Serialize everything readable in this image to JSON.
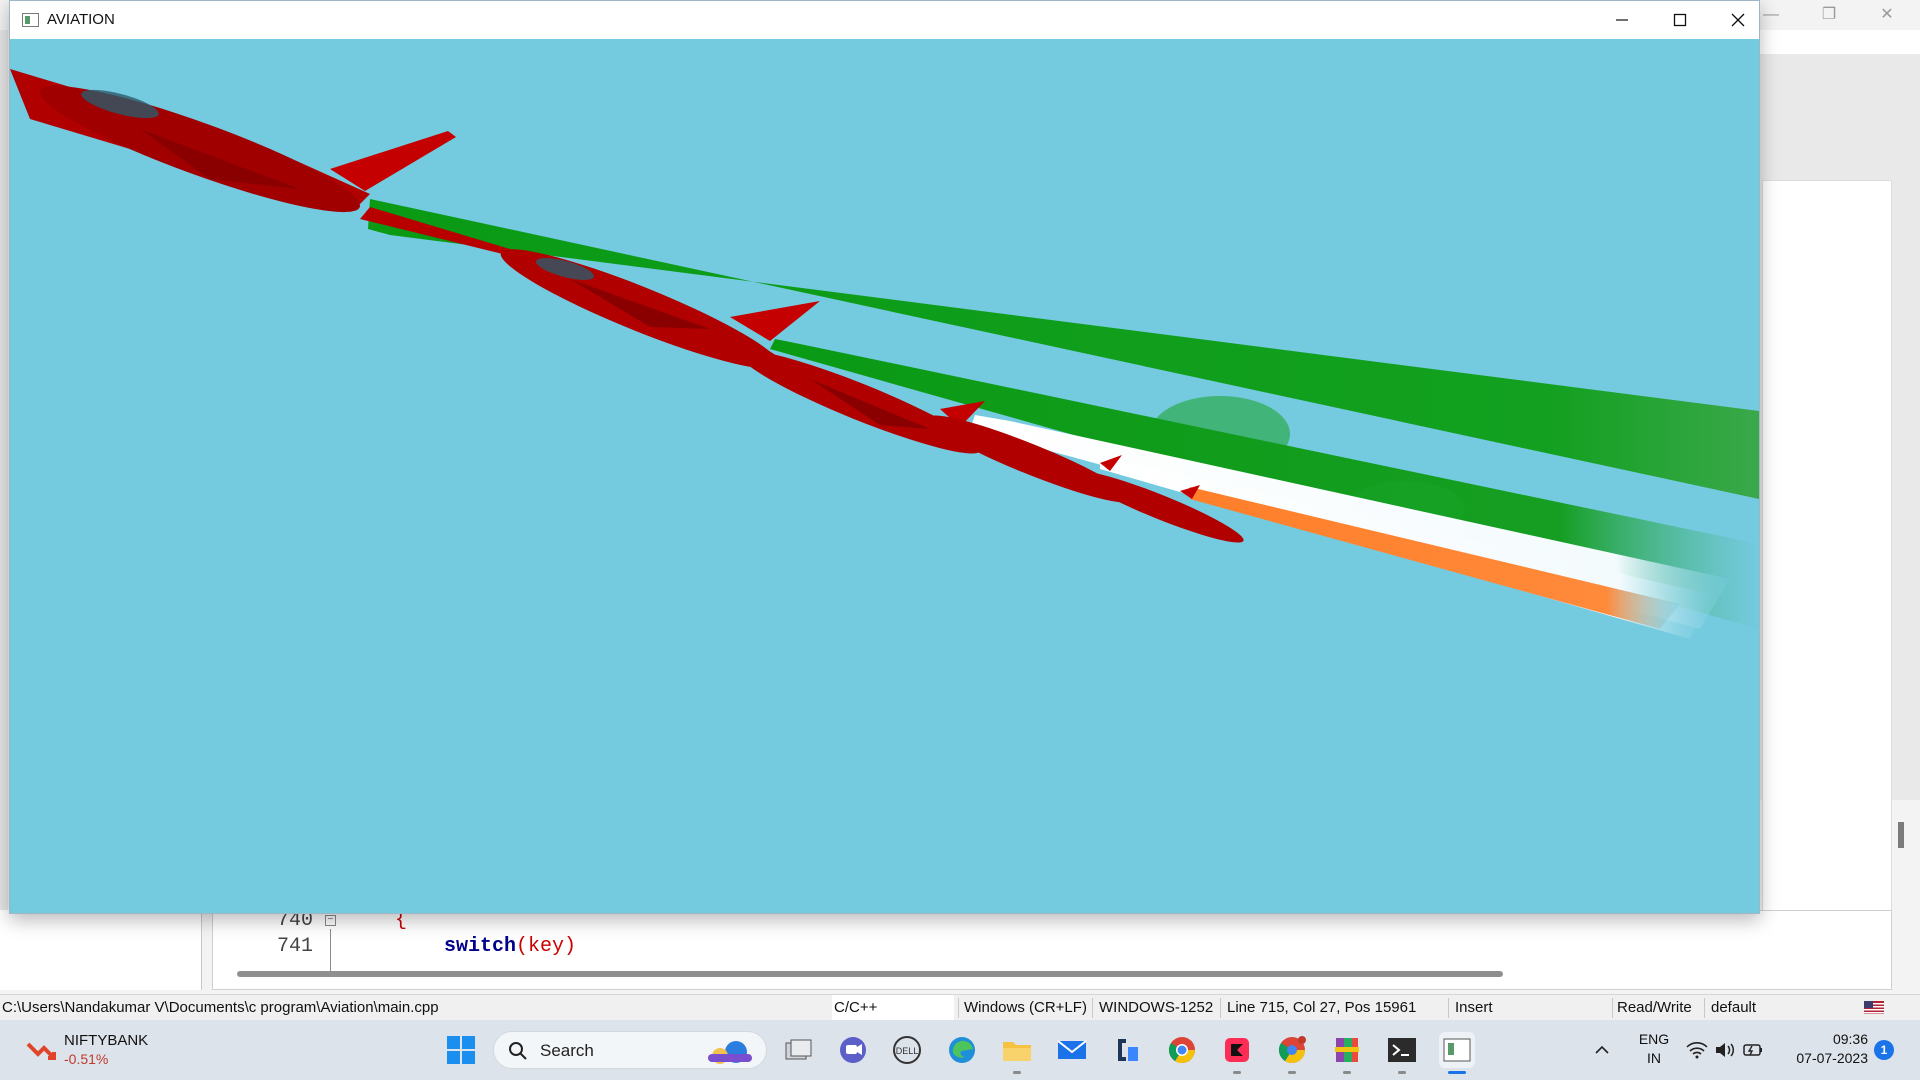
{
  "ide": {
    "statusbar": {
      "path": "C:\\Users\\Nandakumar V\\Documents\\c program\\Aviation\\main.cpp",
      "language": "C/C++",
      "line_endings": "Windows (CR+LF)",
      "encoding": "WINDOWS-1252",
      "cursor": "Line 715, Col 27, Pos 15961",
      "mode": "Insert",
      "access": "Read/Write",
      "profile": "default"
    },
    "editor": {
      "lines": [
        {
          "num": "740",
          "text": "{"
        },
        {
          "num": "741",
          "keyword": "switch",
          "rest": "(key)"
        }
      ]
    }
  },
  "aviation_window": {
    "title": "AVIATION",
    "colors": {
      "sky": "#74cadf",
      "plane_red": "#b00000",
      "trail_green": "#0a9a14",
      "trail_white": "#ffffff",
      "trail_orange": "#ff7f2a"
    }
  },
  "taskbar": {
    "weather_name": "NIFTYBANK",
    "weather_change": "-0.51%",
    "search_label": "Search",
    "tray_lang_1": "ENG",
    "tray_lang_2": "IN",
    "time": "09:36",
    "date": "07-07-2023",
    "notification_count": "1"
  }
}
